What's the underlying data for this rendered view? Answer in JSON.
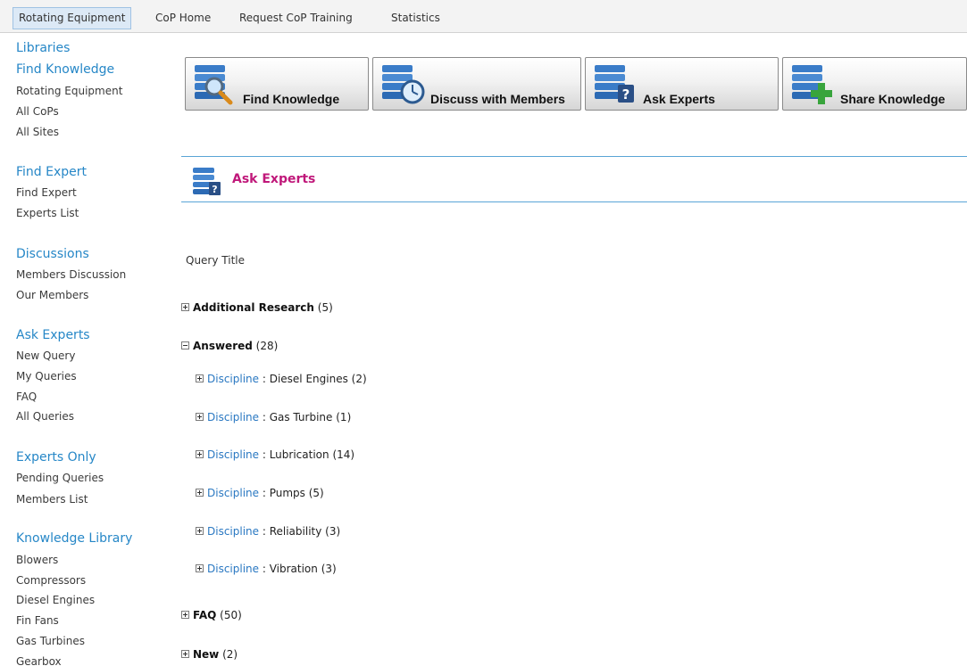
{
  "topnav": {
    "tabs": [
      {
        "label": "Rotating Equipment",
        "active": true
      },
      {
        "label": "CoP Home",
        "active": false
      },
      {
        "label": "Request CoP Training",
        "active": false
      },
      {
        "label": "Statistics",
        "active": false
      }
    ]
  },
  "sidebar": {
    "libraries": "Libraries",
    "find_knowledge": {
      "heading": "Find Knowledge",
      "items": [
        "Rotating Equipment",
        "All CoPs",
        "All Sites"
      ]
    },
    "find_expert": {
      "heading": "Find Expert",
      "items": [
        "Find Expert",
        "Experts List"
      ]
    },
    "discussions": {
      "heading": "Discussions",
      "items": [
        "Members Discussion",
        "Our Members"
      ]
    },
    "ask_experts": {
      "heading": "Ask Experts",
      "items": [
        "New Query",
        "My Queries",
        "FAQ",
        "All Queries"
      ]
    },
    "experts_only": {
      "heading": "Experts Only",
      "items": [
        "Pending Queries",
        "Members List"
      ]
    },
    "knowledge_library": {
      "heading": "Knowledge Library",
      "items": [
        "Blowers",
        "Compressors",
        "Diesel Engines",
        "Fin Fans",
        "Gas Turbines",
        "Gearbox"
      ]
    }
  },
  "actions": [
    {
      "label": "Find Knowledge",
      "icon": "find-knowledge-icon"
    },
    {
      "label": "Discuss with Members",
      "icon": "discuss-members-icon"
    },
    {
      "label": "Ask Experts",
      "icon": "ask-experts-icon"
    },
    {
      "label": "Share Knowledge",
      "icon": "share-knowledge-icon"
    }
  ],
  "section": {
    "title": "Ask Experts"
  },
  "list": {
    "column_header": "Query Title",
    "groups": [
      {
        "name": "Additional Research",
        "count": "(5)",
        "expanded": false
      },
      {
        "name": "Answered",
        "count": "(28)",
        "expanded": true
      },
      {
        "name": "FAQ",
        "count": "(50)",
        "expanded": false
      },
      {
        "name": "New",
        "count": "(2)",
        "expanded": false
      }
    ],
    "discipline_label": "Discipline",
    "separator": " : ",
    "subgroups": [
      {
        "value": "Diesel Engines",
        "count": "(2)"
      },
      {
        "value": "Gas Turbine",
        "count": "(1)"
      },
      {
        "value": "Lubrication",
        "count": "(14)"
      },
      {
        "value": "Pumps",
        "count": "(5)"
      },
      {
        "value": "Reliability",
        "count": "(3)"
      },
      {
        "value": "Vibration",
        "count": "(3)"
      }
    ]
  },
  "colors": {
    "accent": "#2687c7",
    "section_title": "#c0187a",
    "link": "#2a78c2"
  }
}
